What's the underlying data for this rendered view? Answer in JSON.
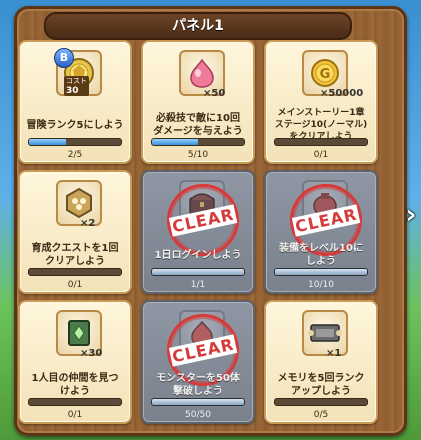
{
  "panel": {
    "title": "パネル1"
  },
  "cards": [
    {
      "icon": "rank-badge-icon",
      "badge": "B",
      "cost_label": "コスト",
      "cost_value": "30",
      "qty": "",
      "desc": "冒険ランク5にしよう",
      "progress": "2/5",
      "fraction": 0.4,
      "done": false
    },
    {
      "icon": "pink-slime-gem-icon",
      "qty": "×50",
      "desc": "必殺技で敵に10回\nダメージを与えよう",
      "progress": "5/10",
      "fraction": 0.5,
      "done": false
    },
    {
      "icon": "gold-coin-icon",
      "qty": "×50000",
      "desc": "メインストーリー1章\nステージ10(ノーマル)\nをクリアしよう",
      "progress": "0/1",
      "fraction": 0.0,
      "done": false
    },
    {
      "icon": "training-token-icon",
      "qty": "×2",
      "desc": "育成クエストを1回\nクリアしよう",
      "progress": "0/1",
      "fraction": 0.0,
      "done": false
    },
    {
      "icon": "treasure-box-icon",
      "qty": "",
      "desc": "1日ログインしよう",
      "progress": "1/1",
      "fraction": 1.0,
      "done": true,
      "stamp": "CLEAR"
    },
    {
      "icon": "gem-pouch-icon",
      "qty": "",
      "desc": "装備をレベル10に\nしよう",
      "progress": "10/10",
      "fraction": 1.0,
      "done": true,
      "stamp": "CLEAR"
    },
    {
      "icon": "skill-book-icon",
      "qty": "×30",
      "desc": "1人目の仲間を見つ\nけよう",
      "progress": "0/1",
      "fraction": 0.0,
      "done": false
    },
    {
      "icon": "slime-item-icon",
      "qty": "",
      "desc": "モンスターを50体\n撃破しよう",
      "progress": "50/50",
      "fraction": 1.0,
      "done": true,
      "stamp": "CLEAR"
    },
    {
      "icon": "ticket-icon",
      "qty": "×1",
      "desc": "メモリを5回ランク\nアップしよう",
      "progress": "0/5",
      "fraction": 0.0,
      "done": false
    }
  ],
  "colors": {
    "clear_red": "#d63a3a",
    "bar_blue": "#3a8fd8"
  }
}
